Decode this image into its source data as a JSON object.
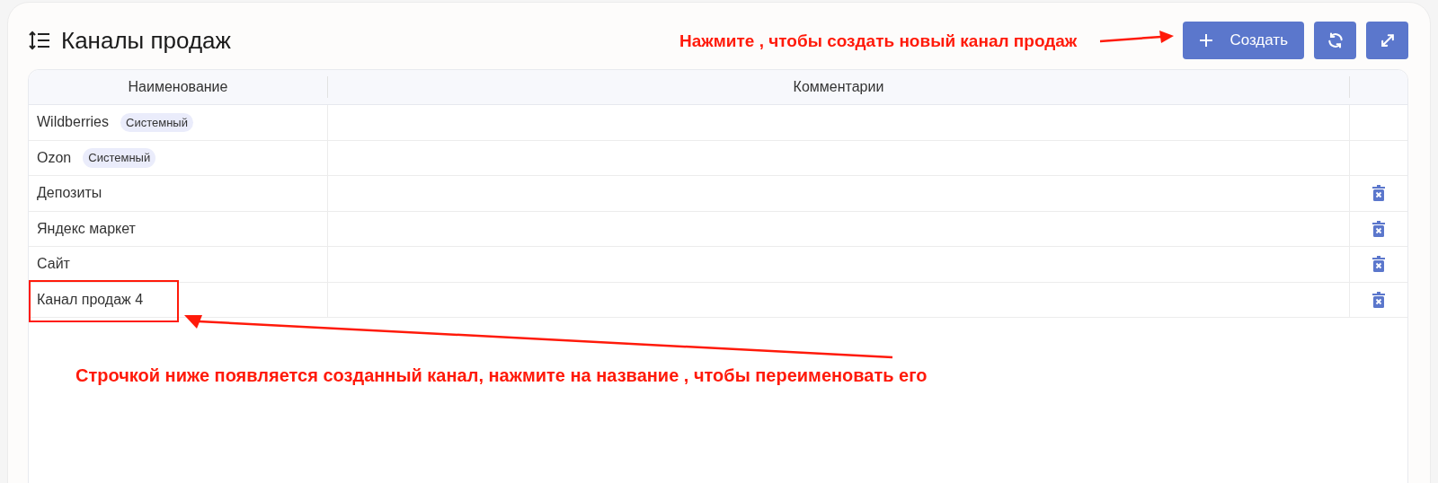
{
  "title": "Каналы продаж",
  "buttons": [
    {
      "kind": "create",
      "label": "Создать"
    },
    {
      "kind": "refresh"
    },
    {
      "kind": "expand"
    }
  ],
  "table": {
    "columns": [
      "Наименование",
      "Комментарии"
    ],
    "rows": [
      {
        "name": "Wildberries",
        "badge": "Системный",
        "deletable": false,
        "highlighted": false
      },
      {
        "name": "Ozon",
        "badge": "Системный",
        "deletable": false,
        "highlighted": false
      },
      {
        "name": "Депозиты",
        "deletable": true,
        "highlighted": false
      },
      {
        "name": "Яндекс маркет",
        "deletable": true,
        "highlighted": false
      },
      {
        "name": "Сайт",
        "deletable": true,
        "highlighted": false
      },
      {
        "name": "Канал продаж 4",
        "deletable": true,
        "highlighted": true
      }
    ]
  },
  "annotations": [
    "Нажмите , чтобы создать новый канал продаж",
    "Строчкой ниже появляется созданный канал, нажмите на название , чтобы переименовать его"
  ]
}
